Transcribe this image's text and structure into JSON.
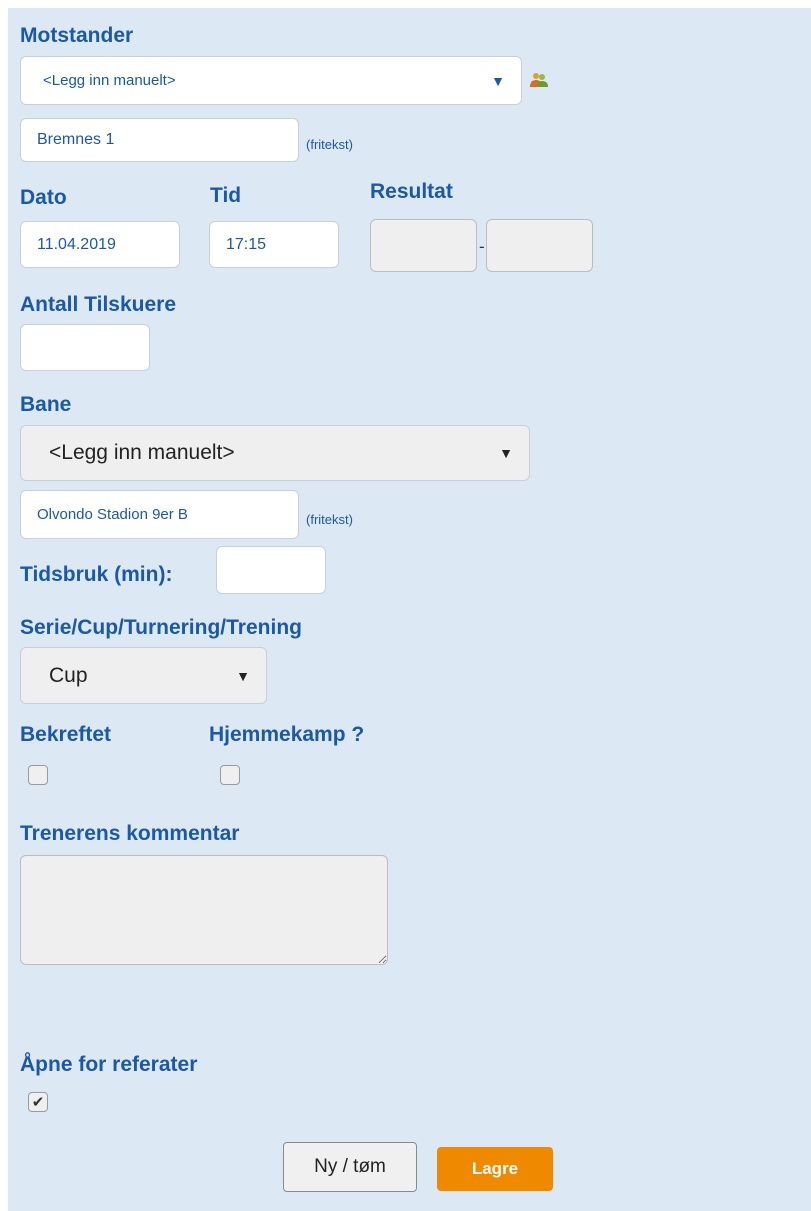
{
  "motstander": {
    "label": "Motstander",
    "select_value": "<Legg inn manuelt>",
    "freetext_value": "Bremnes 1",
    "freetext_hint": "(fritekst)",
    "icon": "people-icon"
  },
  "dato": {
    "label": "Dato",
    "value": "11.04.2019"
  },
  "tid": {
    "label": "Tid",
    "value": "17:15"
  },
  "resultat": {
    "label": "Resultat",
    "separator": "-",
    "home": "",
    "away": ""
  },
  "tilskuere": {
    "label": "Antall Tilskuere",
    "value": ""
  },
  "bane": {
    "label": "Bane",
    "select_value": "<Legg inn manuelt>",
    "freetext_value": "Olvondo Stadion 9er B",
    "freetext_hint": "(fritekst)"
  },
  "tidsbruk": {
    "label": "Tidsbruk (min):",
    "value": ""
  },
  "serie": {
    "label": "Serie/Cup/Turnering/Trening",
    "select_value": "Cup"
  },
  "bekreftet": {
    "label": "Bekreftet",
    "checked": false
  },
  "hjemmekamp": {
    "label": "Hjemmekamp ?",
    "checked": false
  },
  "kommentar": {
    "label": "Trenerens kommentar",
    "value": ""
  },
  "referater": {
    "label": "Åpne for referater",
    "checked": true,
    "check_mark": "✔"
  },
  "buttons": {
    "new_label": "Ny / tøm",
    "save_label": "Lagre"
  },
  "colors": {
    "accent": "#1b58a8",
    "panel_bg": "#dde8f5",
    "save_button": "#ef8a00"
  }
}
